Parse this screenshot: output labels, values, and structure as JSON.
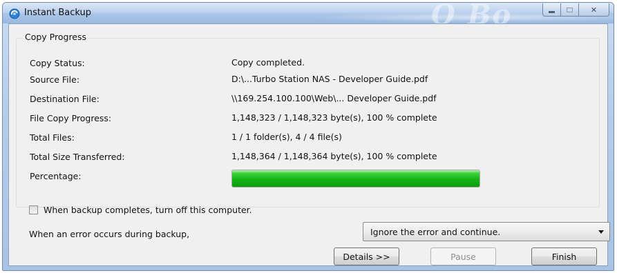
{
  "window": {
    "title": "Instant Backup",
    "title_decoration": "O Bo"
  },
  "copy_progress": {
    "group_title": "Copy Progress",
    "rows": [
      {
        "label": "Copy Status:",
        "value": "Copy completed."
      },
      {
        "label": "Source File:",
        "value": "D:\\...Turbo Station NAS - Developer Guide.pdf"
      },
      {
        "label": "Destination File:",
        "value": "\\\\169.254.100.100\\Web\\... Developer Guide.pdf"
      },
      {
        "label": "File Copy Progress:",
        "value": "1,148,323 / 1,148,323 byte(s),  100 % complete"
      },
      {
        "label": "Total Files:",
        "value": "1 / 1 folder(s), 4 / 4 file(s)"
      },
      {
        "label": "Total Size Transferred:",
        "value": "1,148,364 / 1,148,364 byte(s),  100 % complete"
      }
    ],
    "percentage_label": "Percentage:",
    "percentage_value": 100
  },
  "options": {
    "shutdown_label": "When backup completes, turn off this computer.",
    "shutdown_checked": false,
    "error_label": "When an error occurs during backup,",
    "error_action_selected": "Ignore the error and continue."
  },
  "buttons": {
    "details": "Details >>",
    "pause": "Pause",
    "finish": "Finish"
  },
  "colors": {
    "progress_green": "#16b414",
    "titlebar_blue": "#bcd2ee"
  }
}
